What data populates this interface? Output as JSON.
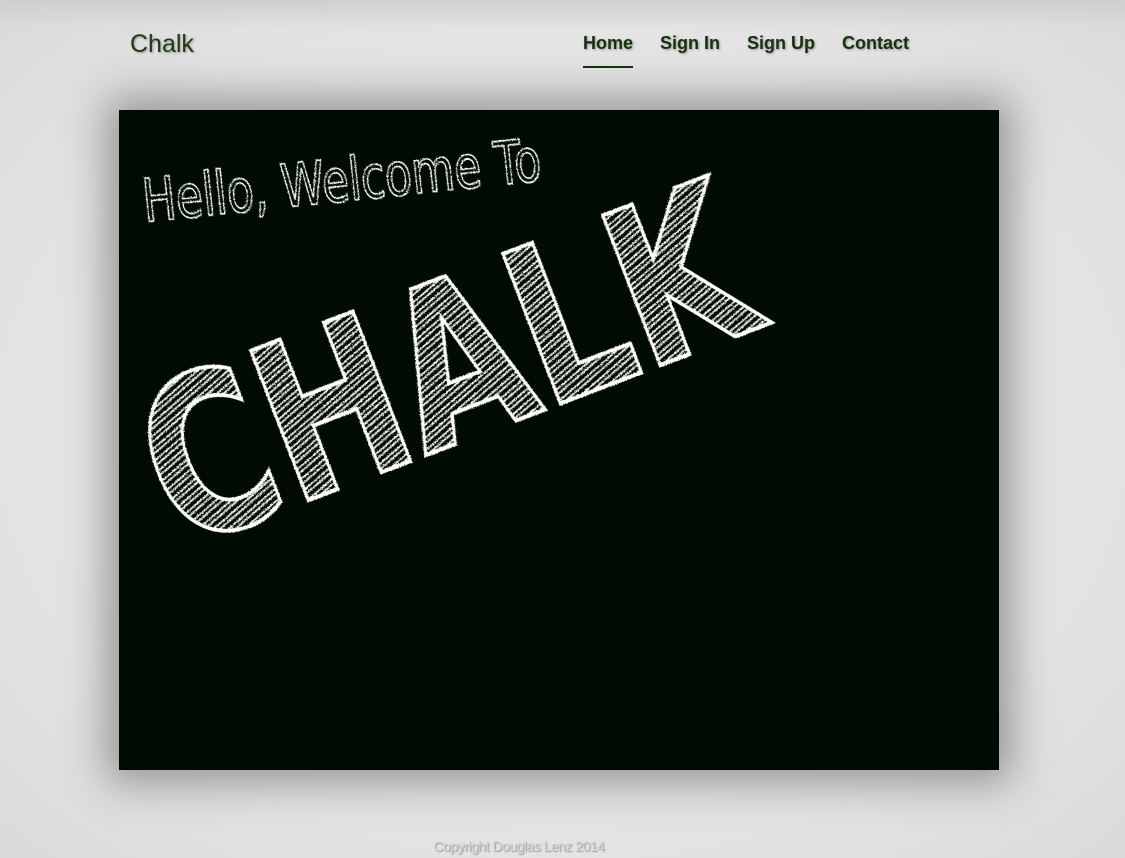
{
  "header": {
    "brand": "Chalk"
  },
  "nav": {
    "items": [
      {
        "label": "Home",
        "active": true
      },
      {
        "label": "Sign In",
        "active": false
      },
      {
        "label": "Sign Up",
        "active": false
      },
      {
        "label": "Contact",
        "active": false
      }
    ]
  },
  "hero": {
    "greeting": "Hello, Welcome To",
    "title": "CHALK"
  },
  "footer": {
    "copyright": "Copyright Douglas Lenz 2014"
  },
  "colors": {
    "board": "#000c02",
    "chalk": "#ffffff",
    "brand_green": "#17310f"
  }
}
